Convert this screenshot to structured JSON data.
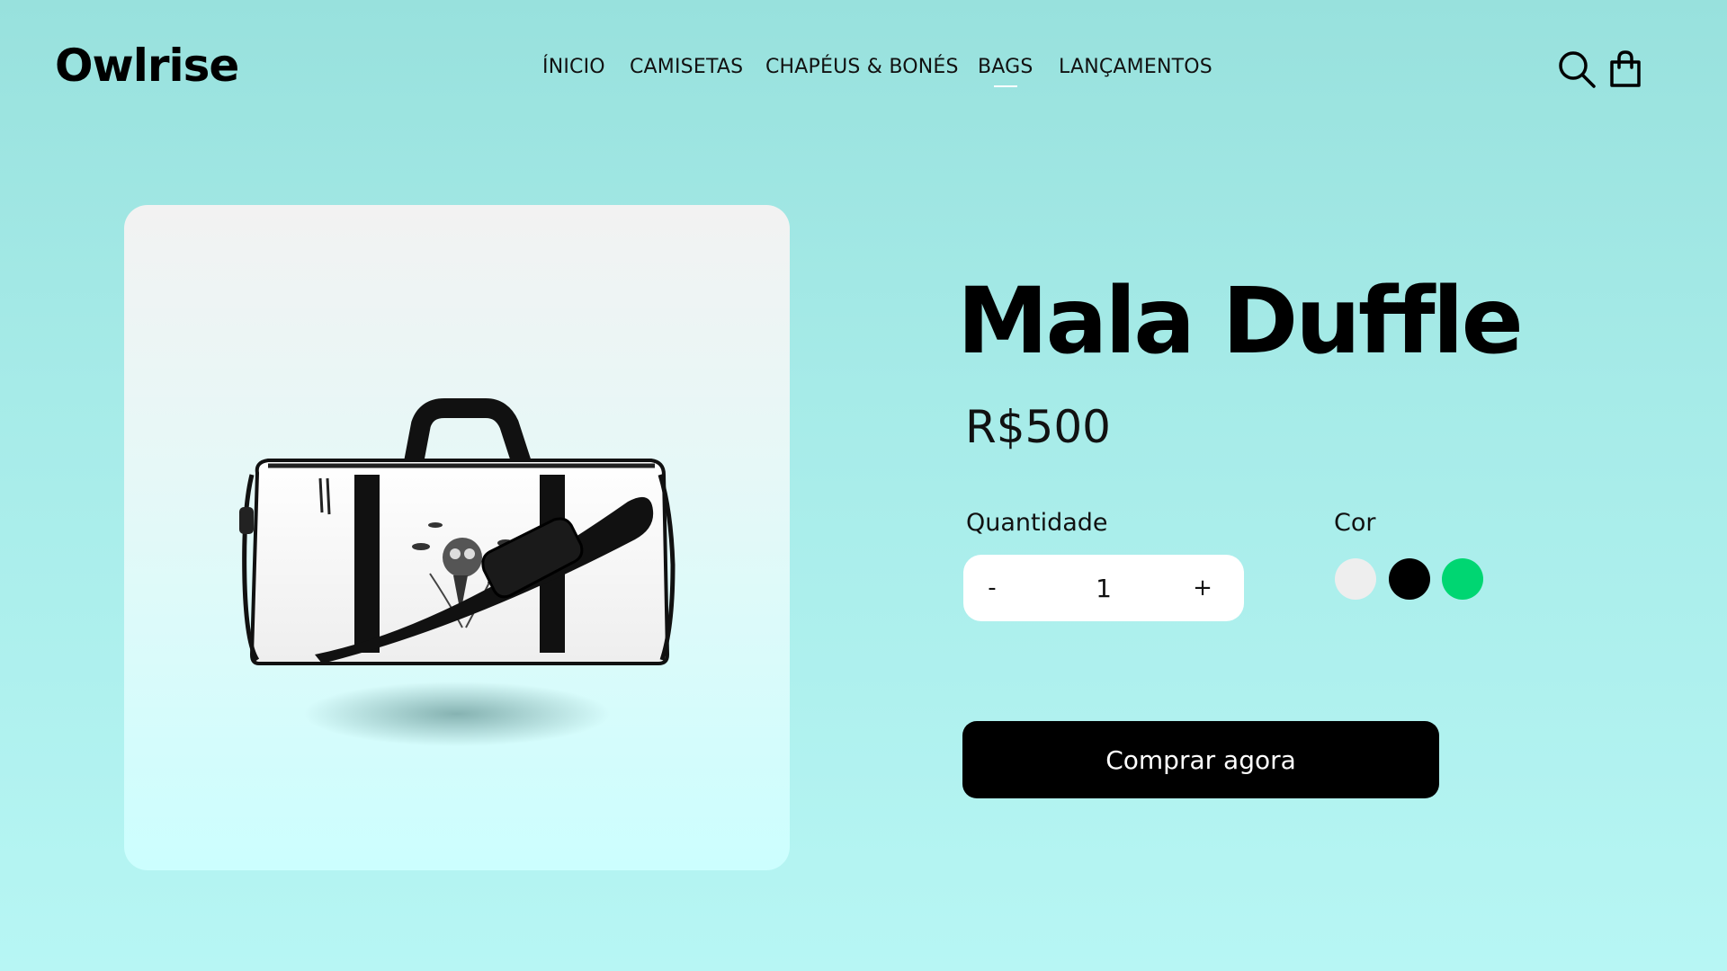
{
  "header": {
    "logo": "Owlrise",
    "nav": [
      {
        "label": "ÍNICIO"
      },
      {
        "label": "CAMISETAS"
      },
      {
        "label": "CHAPÉUS & BONÉS"
      },
      {
        "label": "BAGS",
        "active": true
      },
      {
        "label": "LANÇAMENTOS"
      }
    ],
    "icons": [
      "search-icon",
      "shopping-bag-icon"
    ]
  },
  "product": {
    "image_icon": "duffle-bag-image",
    "title": "Mala Duffle",
    "price": "R$500",
    "quantity_label": "Quantidade",
    "quantity_minus": "-",
    "quantity_value": "1",
    "quantity_plus": "+",
    "color_label": "Cor",
    "colors": [
      "#eeeeee",
      "#000000",
      "#00d672"
    ],
    "buy_label": "Comprar agora"
  },
  "colors": {
    "background_top": "#98e1dd",
    "background_bottom": "#b7f6f4",
    "button": "#000000"
  }
}
